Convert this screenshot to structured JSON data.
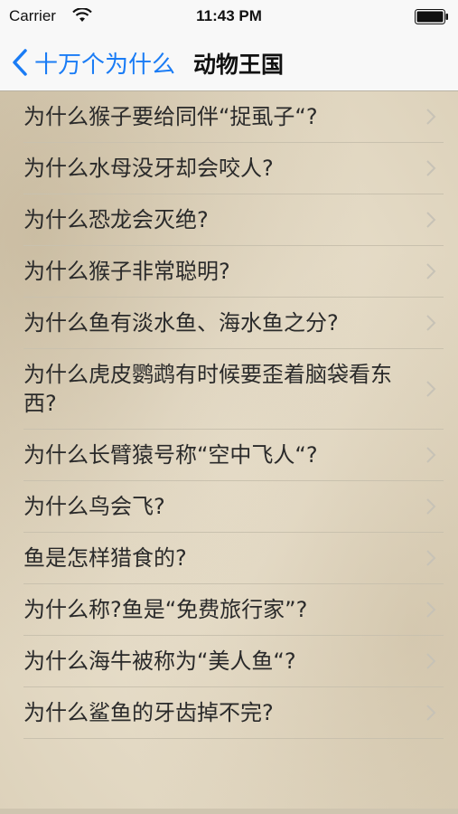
{
  "status": {
    "carrier": "Carrier",
    "time": "11:43 PM"
  },
  "nav": {
    "back_label": "十万个为什么",
    "title": "动物王国"
  },
  "colors": {
    "accent": "#1a7cf5",
    "chevron": "#c7c2b6"
  },
  "items": [
    "为什么猴子要给同伴“捉虱子“?",
    "为什么水母没牙却会咬人?",
    "为什么恐龙会灭绝?",
    "为什么猴子非常聪明?",
    "为什么鱼有淡水鱼、海水鱼之分?",
    "为什么虎皮鹦鹉有时候要歪着脑袋看东西?",
    "为什么长臂猿号称“空中飞人“?",
    "为什么鸟会飞?",
    "鱼是怎样猎食的?",
    "为什么称?鱼是“免费旅行家”?",
    "为什么海牛被称为“美人鱼“?",
    "为什么鲨鱼的牙齿掉不完?"
  ]
}
